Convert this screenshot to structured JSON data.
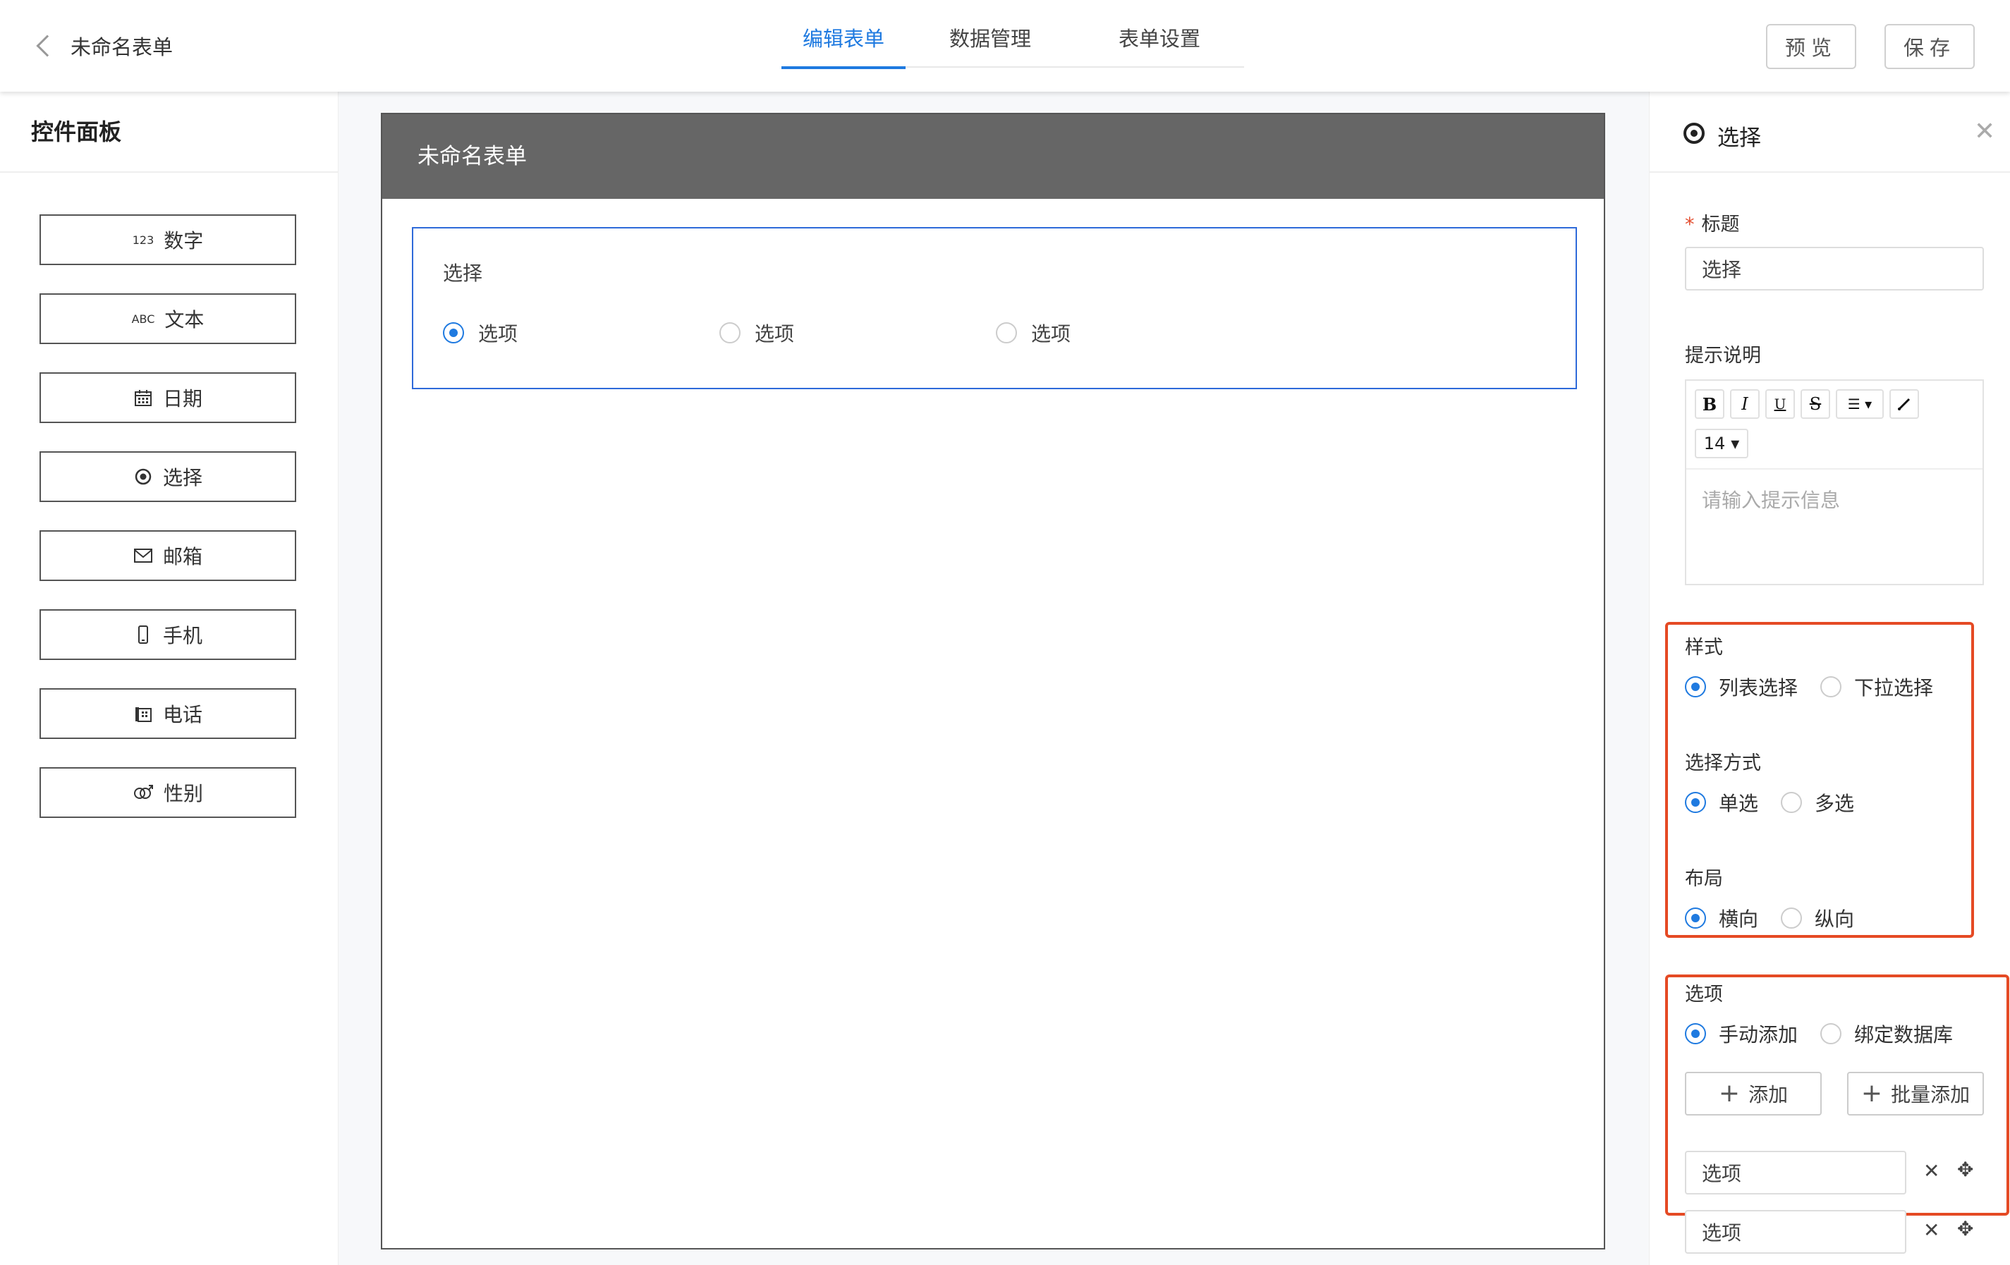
{
  "header": {
    "back_title": "未命名表单",
    "tabs": [
      {
        "label": "编辑表单",
        "active": true
      },
      {
        "label": "数据管理",
        "active": false
      },
      {
        "label": "表单设置",
        "active": false
      }
    ],
    "preview_label": "预览",
    "save_label": "保存"
  },
  "left_panel": {
    "title": "控件面板",
    "controls": [
      {
        "icon": "123",
        "label": "数字",
        "icon_name": "number-icon"
      },
      {
        "icon": "ABC",
        "label": "文本",
        "icon_name": "text-icon"
      },
      {
        "icon": "📅",
        "label": "日期",
        "icon_name": "calendar-icon"
      },
      {
        "icon": "◉",
        "label": "选择",
        "icon_name": "radio-icon"
      },
      {
        "icon": "✉",
        "label": "邮箱",
        "icon_name": "mail-icon"
      },
      {
        "icon": "▯",
        "label": "手机",
        "icon_name": "mobile-icon"
      },
      {
        "icon": "☎",
        "label": "电话",
        "icon_name": "phone-icon"
      },
      {
        "icon": "⚥",
        "label": "性别",
        "icon_name": "gender-icon"
      }
    ]
  },
  "canvas": {
    "form_title": "未命名表单",
    "field": {
      "label": "选择",
      "options": [
        {
          "label": "选项",
          "selected": true
        },
        {
          "label": "选项",
          "selected": false
        },
        {
          "label": "选项",
          "selected": false
        }
      ]
    }
  },
  "right_panel": {
    "title": "选择",
    "title_label": "标题",
    "title_value": "选择",
    "hint_label": "提示说明",
    "hint_font_size": "14",
    "hint_placeholder": "请输入提示信息",
    "style_label": "样式",
    "style_options": [
      "列表选择",
      "下拉选择"
    ],
    "mode_label": "选择方式",
    "mode_options": [
      "单选",
      "多选"
    ],
    "layout_label": "布局",
    "layout_options": [
      "横向",
      "纵向"
    ],
    "options_label": "选项",
    "source_options": [
      "手动添加",
      "绑定数据库"
    ],
    "add_label": "添加",
    "bulk_add_label": "批量添加",
    "option_rows": [
      "选项",
      "选项"
    ]
  },
  "colors": {
    "accent": "#1f7ae0",
    "highlight": "#e54a24",
    "header_gray": "#666666"
  }
}
